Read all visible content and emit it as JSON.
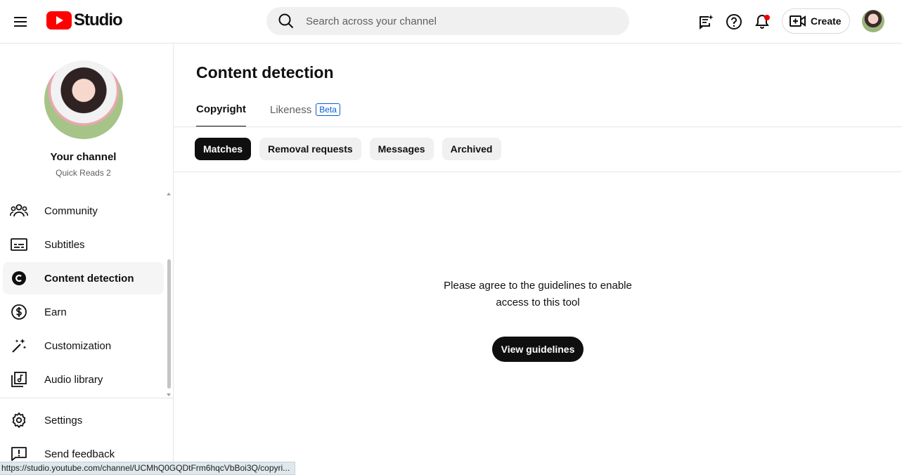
{
  "topbar": {
    "logo_text": "Studio",
    "search_placeholder": "Search across your channel",
    "create_label": "Create"
  },
  "channel": {
    "title": "Your channel",
    "subtitle": "Quick Reads 2"
  },
  "sidebar": {
    "items": [
      {
        "label": "Community",
        "icon": "community-icon"
      },
      {
        "label": "Subtitles",
        "icon": "subtitles-icon"
      },
      {
        "label": "Content detection",
        "icon": "copyright-icon",
        "active": true
      },
      {
        "label": "Earn",
        "icon": "dollar-icon"
      },
      {
        "label": "Customization",
        "icon": "magic-wand-icon"
      },
      {
        "label": "Audio library",
        "icon": "audio-library-icon"
      }
    ],
    "bottom_items": [
      {
        "label": "Settings",
        "icon": "gear-icon"
      },
      {
        "label": "Send feedback",
        "icon": "feedback-icon"
      }
    ]
  },
  "main": {
    "title": "Content detection",
    "tabs": [
      {
        "label": "Copyright",
        "active": true
      },
      {
        "label": "Likeness",
        "badge": "Beta"
      }
    ],
    "chips": [
      {
        "label": "Matches",
        "active": true
      },
      {
        "label": "Removal requests"
      },
      {
        "label": "Messages"
      },
      {
        "label": "Archived"
      }
    ],
    "message": "Please agree to the guidelines to enable access to this tool",
    "button_label": "View guidelines"
  },
  "statusbar": {
    "url": "https://studio.youtube.com/channel/UCMhQ0GQDtFrm6hqcVbBoi3Q/copyri..."
  },
  "colors": {
    "brand_red": "#ff0000",
    "link_blue": "#065fd4",
    "dark": "#0f0f0f"
  }
}
